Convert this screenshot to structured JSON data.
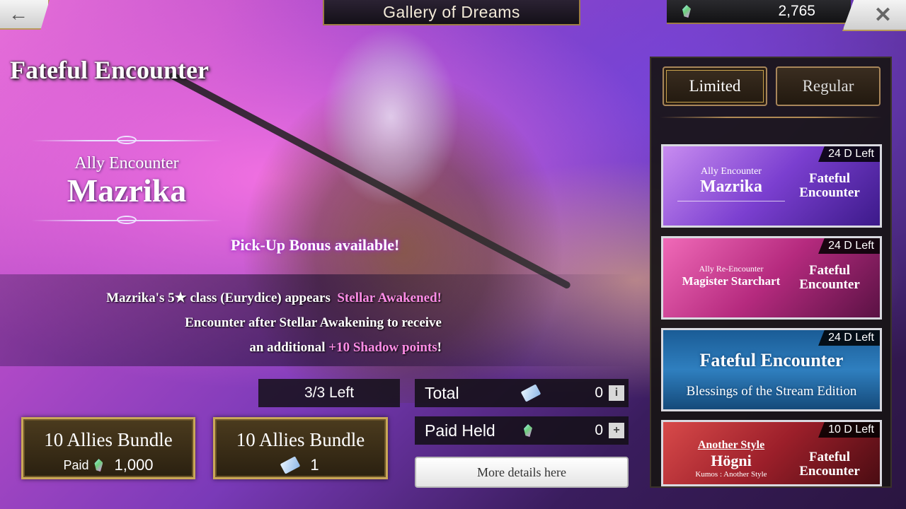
{
  "header": {
    "title": "Gallery of Dreams",
    "currency_amount": "2,765"
  },
  "banner": {
    "title": "Fateful Encounter",
    "ally_sub": "Ally Encounter",
    "ally_name": "Mazrika",
    "pickup": "Pick-Up Bonus available!",
    "desc_line1_a": "Mazrika's 5★ class (Eurydice) appears",
    "desc_line1_b": "Stellar Awakened!",
    "desc_line2": "Encounter after Stellar Awakening to receive",
    "desc_line3_a": "an additional",
    "desc_line3_b": "+10 Shadow points",
    "desc_line3_c": "!"
  },
  "bottom": {
    "left_count": "3/3 Left",
    "total_label": "Total",
    "total_value": "0",
    "paid_held_label": "Paid Held",
    "paid_held_value": "0",
    "details_label": "More details here",
    "bundle1": {
      "title": "10 Allies Bundle",
      "paid_label": "Paid",
      "cost": "1,000"
    },
    "bundle2": {
      "title": "10 Allies Bundle",
      "cost": "1"
    }
  },
  "panel": {
    "tabs": [
      {
        "label": "Limited",
        "active": true
      },
      {
        "label": "Regular",
        "active": false
      }
    ],
    "cards": [
      {
        "days": "24 D Left",
        "left_small": "Ally Encounter",
        "left_big": "Mazrika",
        "right": "Fateful Encounter"
      },
      {
        "days": "24 D Left",
        "left_small": "Ally Re-Encounter",
        "left_mid": "Magister Starchart",
        "right": "Fateful Encounter"
      },
      {
        "days": "24 D Left",
        "title": "Fateful Encounter",
        "subtitle": "Blessings of the Stream Edition"
      },
      {
        "days": "10 D Left",
        "left_small": "Another Style",
        "left_big": "Högni",
        "left_tiny": "Kumos : Another Style",
        "right": "Fateful Encounter"
      }
    ]
  }
}
